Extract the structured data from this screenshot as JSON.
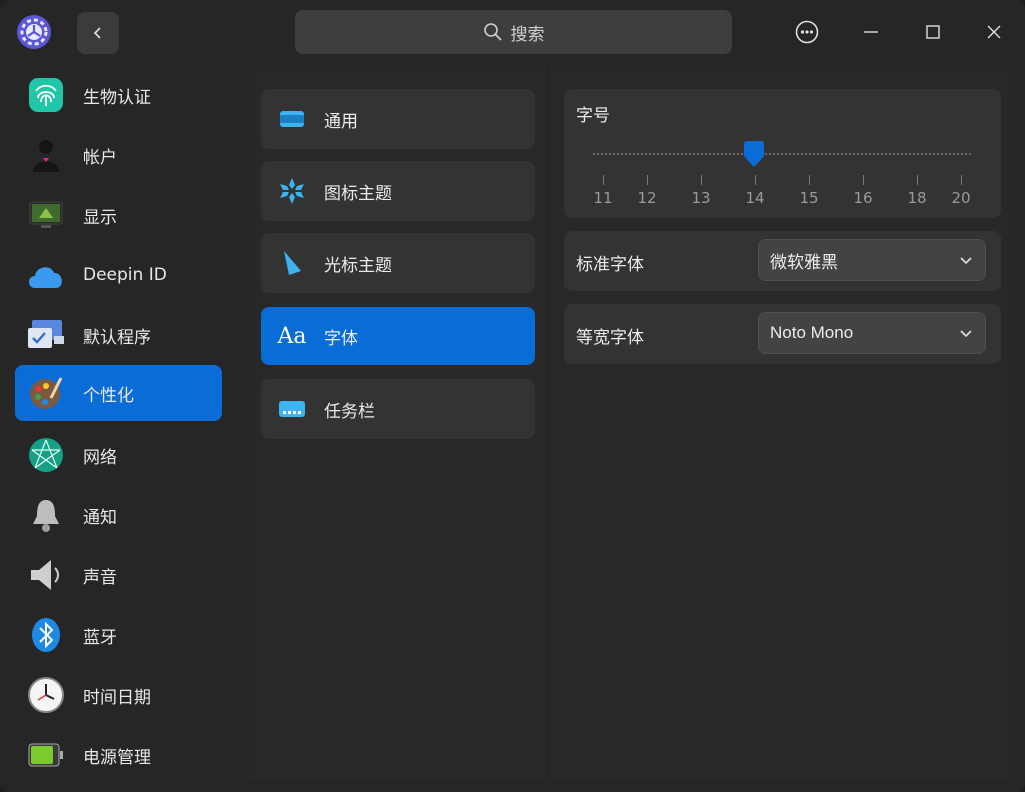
{
  "titlebar": {
    "search_placeholder": "搜索"
  },
  "sidebar": {
    "items": [
      {
        "label": "生物认证",
        "icon": "fingerprint-icon"
      },
      {
        "label": "帐户",
        "icon": "account-icon"
      },
      {
        "label": "显示",
        "icon": "display-icon"
      },
      {
        "label": "Deepin ID",
        "icon": "cloud-icon"
      },
      {
        "label": "默认程序",
        "icon": "default-apps-icon"
      },
      {
        "label": "个性化",
        "icon": "personalization-icon",
        "active": true
      },
      {
        "label": "网络",
        "icon": "network-icon"
      },
      {
        "label": "通知",
        "icon": "bell-icon"
      },
      {
        "label": "声音",
        "icon": "speaker-icon"
      },
      {
        "label": "蓝牙",
        "icon": "bluetooth-icon"
      },
      {
        "label": "时间日期",
        "icon": "clock-icon"
      },
      {
        "label": "电源管理",
        "icon": "battery-icon"
      }
    ]
  },
  "middle": {
    "items": [
      {
        "label": "通用",
        "icon": "window-icon"
      },
      {
        "label": "图标主题",
        "icon": "icon-theme-icon"
      },
      {
        "label": "光标主题",
        "icon": "cursor-icon"
      },
      {
        "label": "字体",
        "icon": "font-icon",
        "glyph": "Aa",
        "active": true
      },
      {
        "label": "任务栏",
        "icon": "taskbar-icon"
      }
    ]
  },
  "font_size": {
    "title": "字号",
    "ticks": [
      "11",
      "12",
      "13",
      "14",
      "15",
      "16",
      "18",
      "20"
    ],
    "selected": "14"
  },
  "standard_font": {
    "label": "标准字体",
    "value": "微软雅黑"
  },
  "mono_font": {
    "label": "等宽字体",
    "value": "Noto Mono"
  },
  "colors": {
    "accent": "#0a6cd6",
    "window_bg": "#262626",
    "card_bg": "#333333"
  }
}
